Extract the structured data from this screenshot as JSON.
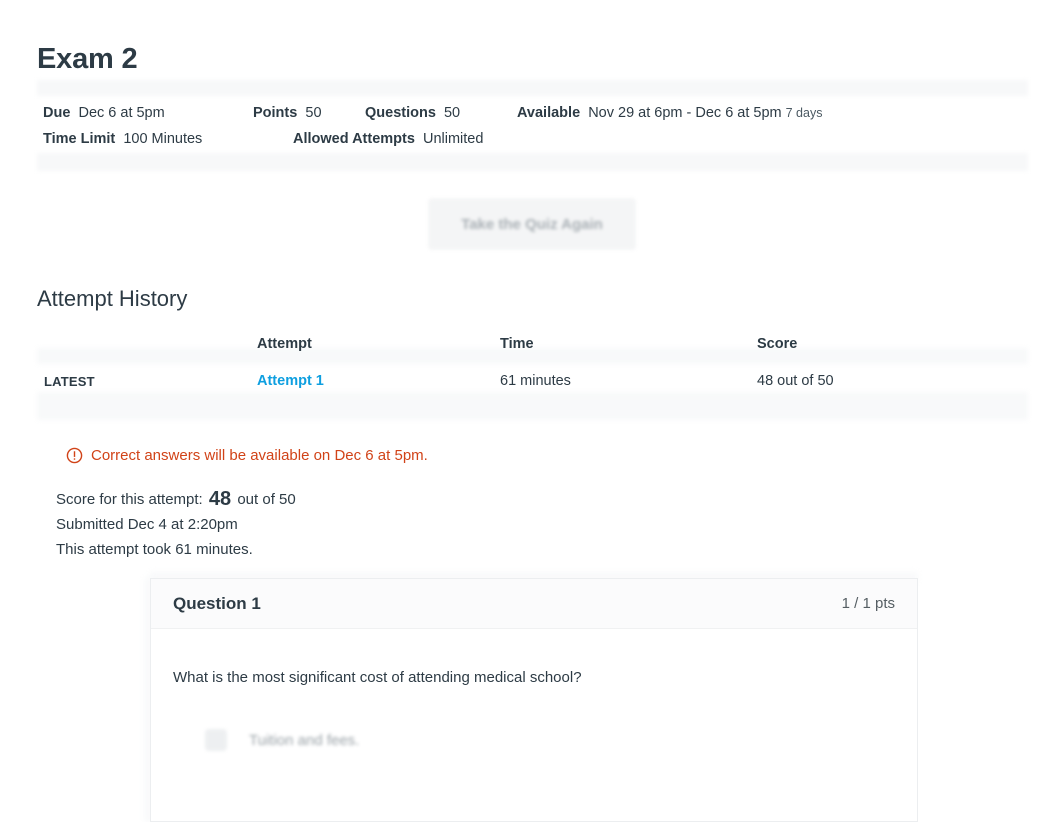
{
  "quiz": {
    "title": "Exam 2",
    "meta": {
      "due_label": "Due",
      "due_value": "Dec 6 at 5pm",
      "points_label": "Points",
      "points_value": "50",
      "questions_label": "Questions",
      "questions_value": "50",
      "available_label": "Available",
      "available_value": "Nov 29 at 6pm - Dec 6 at 5pm",
      "available_duration": "7 days",
      "time_limit_label": "Time Limit",
      "time_limit_value": "100 Minutes",
      "allowed_attempts_label": "Allowed Attempts",
      "allowed_attempts_value": "Unlimited"
    },
    "retake_button_label": "Take the Quiz Again"
  },
  "attempt_history": {
    "section_title": "Attempt History",
    "columns": [
      "",
      "Attempt",
      "Time",
      "Score"
    ],
    "rows": [
      {
        "tag": "LATEST",
        "attempt": "Attempt 1",
        "time": "61 minutes",
        "score": "48 out of 50"
      }
    ]
  },
  "notice": {
    "icon": "warning-circle-icon",
    "text": "Correct answers will be available on Dec 6 at 5pm."
  },
  "score_details": {
    "score_prefix": "Score for this attempt:",
    "score_value": "48",
    "score_suffix": "out of 50",
    "submitted": "Submitted Dec 4 at 2:20pm",
    "duration": "This attempt took 61 minutes."
  },
  "question": {
    "name": "Question 1",
    "points": "1 / 1 pts",
    "text": "What is the most significant cost of attending medical school?",
    "answers": [
      {
        "label": "Tuition and fees."
      }
    ]
  },
  "colors": {
    "link_blue": "#0e9fe0",
    "notice_orange": "#d14318",
    "text": "#2d3b45",
    "muted": "#8e979d"
  }
}
